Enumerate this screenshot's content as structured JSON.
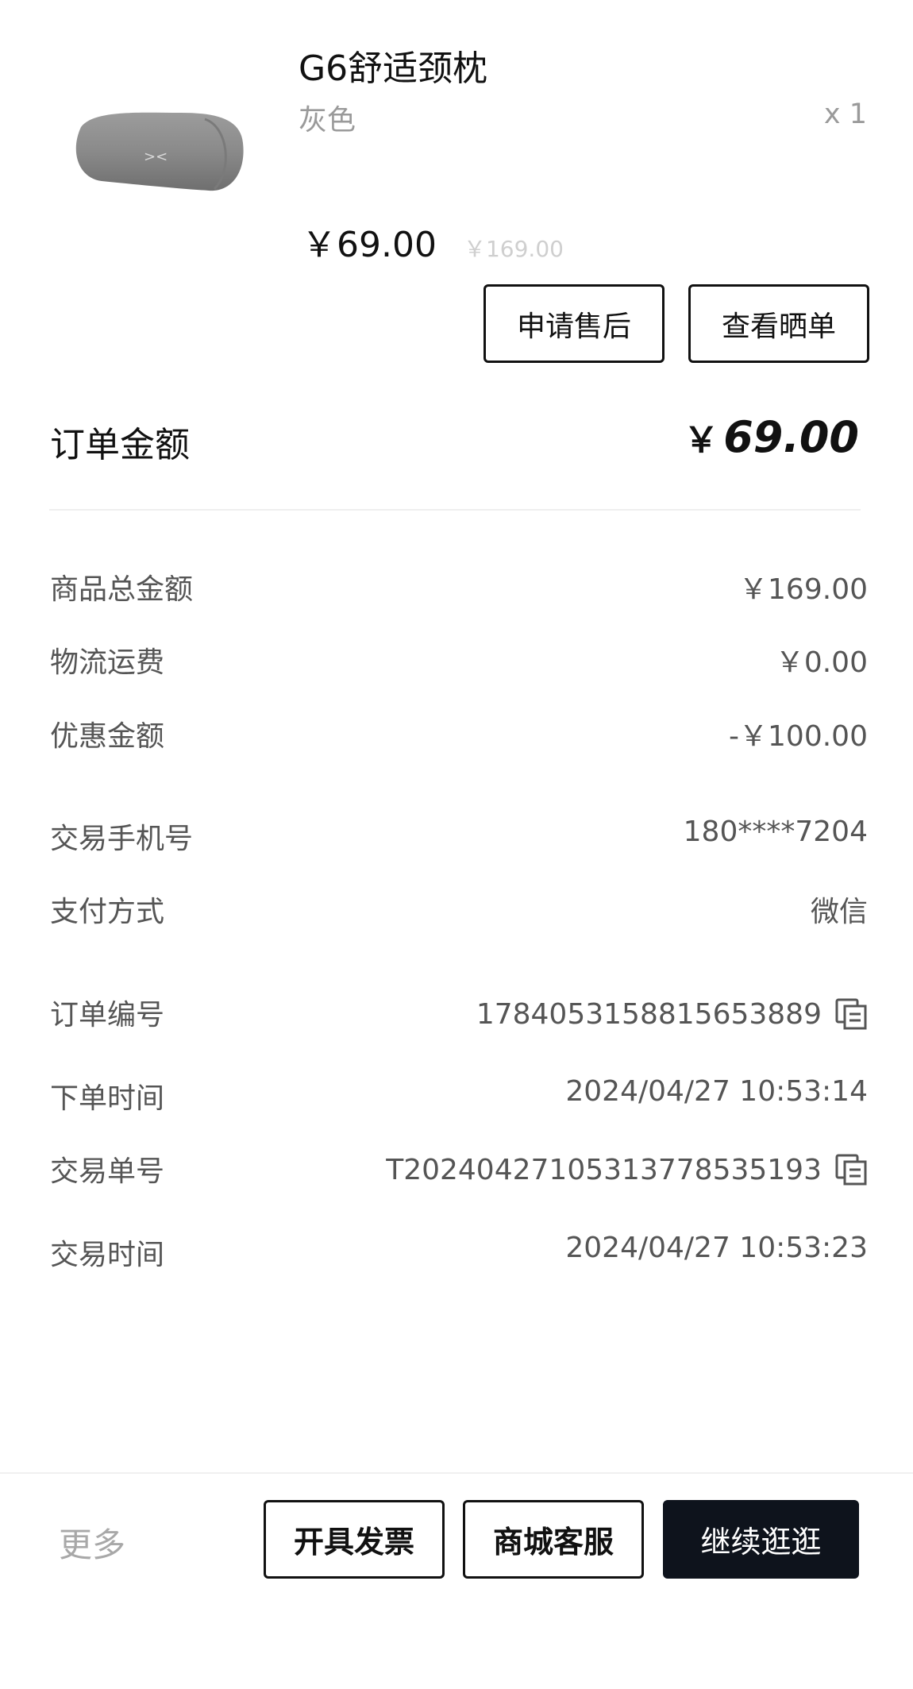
{
  "product": {
    "image_icon": "neck-pillow-image",
    "title": "G6舒适颈枕",
    "variant": "灰色",
    "quantity": "x 1",
    "price": "￥69.00",
    "original_price": "￥169.00"
  },
  "actions": {
    "after_sale": "申请售后",
    "view_review": "查看晒单"
  },
  "order_total": {
    "label": "订单金额",
    "currency": "￥",
    "amount": "69.00"
  },
  "details": {
    "goods_total_label": "商品总金额",
    "goods_total_value": "￥169.00",
    "shipping_label": "物流运费",
    "shipping_value": "￥0.00",
    "discount_label": "优惠金额",
    "discount_value": "-￥100.00",
    "phone_label": "交易手机号",
    "phone_value": "180****7204",
    "payment_label": "支付方式",
    "payment_value": "微信",
    "order_no_label": "订单编号",
    "order_no_value": "1784053158815653889",
    "order_time_label": "下单时间",
    "order_time_value": "2024/04/27 10:53:14",
    "trade_no_label": "交易单号",
    "trade_no_value": "T20240427105313778535193",
    "trade_time_label": "交易时间",
    "trade_time_value": "2024/04/27 10:53:23"
  },
  "bottom_bar": {
    "more": "更多",
    "invoice": "开具发票",
    "service": "商城客服",
    "continue": "继续逛逛"
  },
  "colors": {
    "primary_button": "#0e131c",
    "muted_text": "#9a9a9a"
  }
}
